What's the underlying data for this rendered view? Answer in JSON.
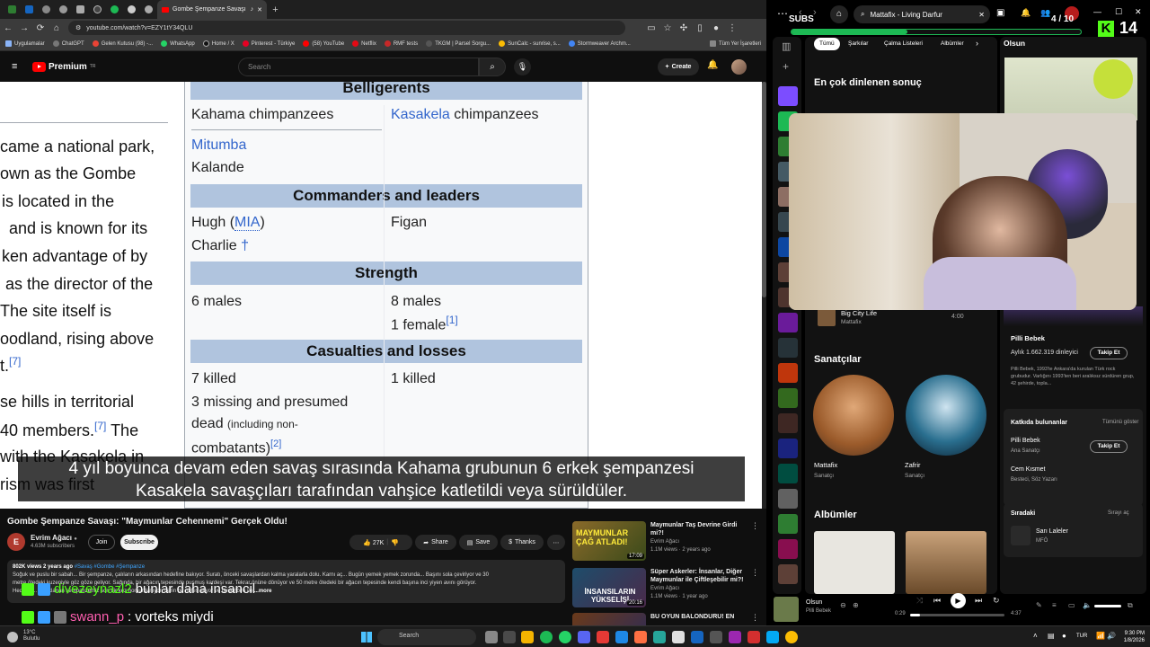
{
  "browser": {
    "active_tab_title": "Gombe Şempanze Savaşı",
    "url": "youtube.com/watch?v=EZY1tY34QLU",
    "bookmarks": [
      "Uygulamalar",
      "ChatGPT",
      "Gelen Kutusu (98) -...",
      "WhatsApp",
      "Home / X",
      "Pinterest - Türkiye",
      "(58) YouTube",
      "Netflix",
      "RMF tests",
      "TKGM | Parsel Sorgu...",
      "SunCalc - sunrise, s...",
      "Stormweaver Archm...",
      "Tüm Yer İşaretleri"
    ]
  },
  "youtube": {
    "brand": "Premium",
    "brand_sup": "TR",
    "search_placeholder": "Search",
    "create_label": "Create"
  },
  "wiki": {
    "left_lines": [
      "came a national park,",
      "own as the Gombe",
      "is located in the",
      "and is known for its",
      "ken advantage of by",
      "as the director of the",
      "The site itself is",
      "oodland, rising above",
      "t.",
      "se hills in territorial",
      "40 members.",
      "with the Kasakela in",
      "rism was first"
    ],
    "refs": [
      "[7]",
      "[7]"
    ],
    "belligerents_header": "Belligerents",
    "bell_left_1": "Kahama chimpanzees",
    "bell_right_link": "Kasakela",
    "bell_right_rest": " chimpanzees",
    "bell_left_link": "Mitumba",
    "bell_left_2": "Kalande",
    "commanders_header": "Commanders and leaders",
    "cmd_left_1a": "Hugh (",
    "cmd_left_1b": "MIA",
    "cmd_left_1c": ")",
    "cmd_left_2": "Charlie",
    "cmd_dagger": "†",
    "cmd_right": "Figan",
    "strength_header": "Strength",
    "str_left": "6 males",
    "str_right_1": "8 males",
    "str_right_2": "1 female",
    "str_ref": "[1]",
    "casualties_header": "Casualties and losses",
    "cas_left_1": "7 killed",
    "cas_left_2": "3 missing and presumed",
    "cas_left_3": "dead",
    "cas_left_3b": "(including non-",
    "cas_left_4": "combatants)",
    "cas_ref": "[2]",
    "cas_right": "1 killed"
  },
  "subtitle": {
    "line1": "4 yıl boyunca devam eden savaş sırasında Kahama grubunun 6 erkek şempanzesi",
    "line2": "Kasakela savaşçıları tarafından vahşice katletildi veya sürüldüler."
  },
  "video": {
    "title": "Gombe Şempanze Savaşı: \"Maymunlar Cehennemi\" Gerçek Oldu!",
    "channel": "Evrim Ağacı",
    "channel_subs": "4.63M subscribers",
    "join": "Join",
    "subscribe": "Subscribe",
    "likes": "27K",
    "share": "Share",
    "save": "Save",
    "thanks": "Thanks",
    "views_meta": "802K views  2 years ago",
    "tags": "#Savaş #Gombe #Şempanze",
    "desc_line1": "Soğuk ve puslu bir sabah... Bir şempanze, çalıların arkasından hedefine bakıyor. Suratı, önceki savaşlardan kalma yaralarla dolu. Karnı aç... Bugün yemek yemek zorunda... Başını sola çeviriyor ve 30",
    "desc_line2": "metre ötedeki kuzeniyle göz göze geliyor. Sağında, bir ağacın tepesinde pusmuş kardeşi var. Tekrar önüne dönüyor ve 50 metre ötedeki bir ağacın tepesinde kendi başına inci yiyen avını görüyor.",
    "desc_line3": "Hedefini... ...saklanan şempanzemiz son bir kez homurdanıyor, derin bir nefes alıyor ve birdenbire ile",
    "more": "...more"
  },
  "related": [
    {
      "title": "Maymunlar Taş Devrine Girdi mi?!",
      "channel": "Evrim Ağacı",
      "meta": "1.1M views · 2 years ago",
      "duration": "17:09",
      "thumb_text": "MAYMUNLAR ÇAĞ ATLADI!"
    },
    {
      "title": "Süper Askerler: İnsanlar, Diğer Maymunlar ile Çiftleşebilir mi?!",
      "channel": "Evrim Ağacı",
      "meta": "1.1M views · 1 year ago",
      "duration": "20:16",
      "thumb_text": "İNSANSILARIN YÜKSELİŞİ"
    },
    {
      "title": "BU OYUN BALONDURU! EN",
      "channel": "",
      "meta": "",
      "duration": "",
      "thumb_text": ""
    }
  ],
  "chat": [
    {
      "user": "divezeynazl2",
      "msg": "bunlar daha insancil"
    },
    {
      "user": "swann_p",
      "msg": "vorteks miydi"
    }
  ],
  "stream_overlay": {
    "subs_label": "SUBS",
    "subs_progress": "4 / 10",
    "subs_progress_fraction": 0.4,
    "kick_count": "14"
  },
  "spotify": {
    "search_value": "Mattafix - Living Darfur",
    "chips": [
      "Tümü",
      "Şarkılar",
      "Çalma Listeleri",
      "Albümler"
    ],
    "top_result_heading": "En çok dinlenen sonuç",
    "track_title": "Big City Life",
    "track_artist": "Mattafix",
    "track_duration": "4:00",
    "artists_heading": "Sanatçılar",
    "artists": [
      {
        "name": "Mattafix",
        "type": "Sanatçı"
      },
      {
        "name": "Zafrir",
        "type": "Sanatçı"
      }
    ],
    "albums_heading": "Albümler",
    "right_heading": "Olsun",
    "right_artist": "Pilli Bebek",
    "right_listeners": "Aylık 1.662.319 dinleyici",
    "follow": "Takip Et",
    "right_bio": "Pilli Bebek, 1993'te Ankara'da kurulan Türk rock grubudur. Varlığını 1993'ten beri aralıksız sürdüren grup, 42 şehirde, topla...",
    "contributors_heading": "Katkıda bulunanlar",
    "show_all": "Tümünü göster",
    "contrib1_name": "Pilli Bebek",
    "contrib1_role": "Ana Sanatçı",
    "contrib2_name": "Cem Kısmet",
    "contrib2_role": "Besteci, Söz Yazarı",
    "queue_heading": "Sıradaki",
    "queue_open": "Sırayı aç",
    "queue_title": "Sarı Laleler",
    "queue_artist": "MFÖ",
    "now_title": "Olsun",
    "now_artist": "Pilli Bebek",
    "time_elapsed": "0:29",
    "time_total": "4:37",
    "progress_fraction": 0.105
  },
  "taskbar": {
    "temp": "13°C",
    "weather": "Bulutlu",
    "search": "Search",
    "lang": "TUR",
    "time": "9:30 PM",
    "date": "1/8/2026"
  }
}
